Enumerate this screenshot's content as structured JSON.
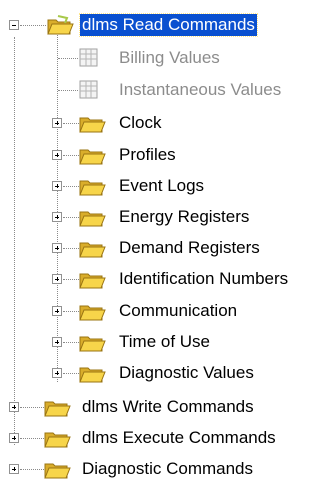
{
  "tree": {
    "root_items": [
      {
        "label": "dlms Read Commands",
        "icon": "folder-icon",
        "expanded": true,
        "selected": true,
        "children": [
          {
            "label": "Billing Values",
            "icon": "table-icon",
            "disabled": true
          },
          {
            "label": "Instantaneous Values",
            "icon": "table-icon",
            "disabled": true
          },
          {
            "label": "Clock",
            "icon": "folder-icon"
          },
          {
            "label": "Profiles",
            "icon": "folder-icon"
          },
          {
            "label": "Event Logs",
            "icon": "folder-icon"
          },
          {
            "label": "Energy Registers",
            "icon": "folder-icon"
          },
          {
            "label": "Demand Registers",
            "icon": "folder-icon"
          },
          {
            "label": "Identification Numbers",
            "icon": "folder-icon"
          },
          {
            "label": "Communication",
            "icon": "folder-icon"
          },
          {
            "label": "Time of Use",
            "icon": "folder-icon"
          },
          {
            "label": "Diagnostic Values",
            "icon": "folder-icon"
          }
        ]
      },
      {
        "label": "dlms Write Commands",
        "icon": "folder-icon"
      },
      {
        "label": "dlms Execute Commands",
        "icon": "folder-icon"
      },
      {
        "label": "Diagnostic Commands",
        "icon": "folder-icon"
      }
    ]
  },
  "colors": {
    "selection": "#0a50d0",
    "disabled_text": "#8c8c8c",
    "folder_yellow": "#f7d54a"
  }
}
